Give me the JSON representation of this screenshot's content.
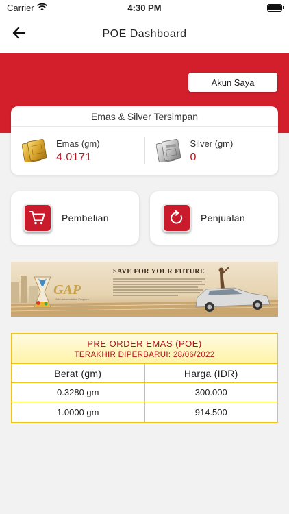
{
  "status_bar": {
    "carrier": "Carrier",
    "time": "4:30 PM"
  },
  "header": {
    "title": "POE Dashboard",
    "back_icon": "arrow-left-icon"
  },
  "account_button": {
    "label": "Akun Saya"
  },
  "holdings": {
    "title": "Emas & Silver Tersimpan",
    "gold": {
      "label": "Emas (gm)",
      "value": "4.0171",
      "icon": "gold-bar-icon"
    },
    "silver": {
      "label": "Silver (gm)",
      "value": "0",
      "icon": "silver-bar-icon"
    }
  },
  "actions": {
    "buy": {
      "label": "Pembelian",
      "icon": "shopping-cart-icon"
    },
    "sell": {
      "label": "Penjualan",
      "icon": "refresh-icon"
    }
  },
  "banner": {
    "title": "SAVE FOR YOUR FUTURE",
    "logo_text": "GAP",
    "logo_subtext": "Gold Accumulation Program"
  },
  "poe": {
    "title": "PRE ORDER EMAS (POE)",
    "updated": "TERAKHIR DIPERBARUI: 28/06/2022",
    "columns": [
      "Berat (gm)",
      "Harga (IDR)"
    ],
    "rows": [
      [
        "0.3280 gm",
        "300.000"
      ],
      [
        "1.0000 gm",
        "914.500"
      ]
    ]
  },
  "colors": {
    "brand_red": "#d31f2c",
    "value_red": "#b3121f",
    "table_border_yellow": "#f0c419"
  }
}
